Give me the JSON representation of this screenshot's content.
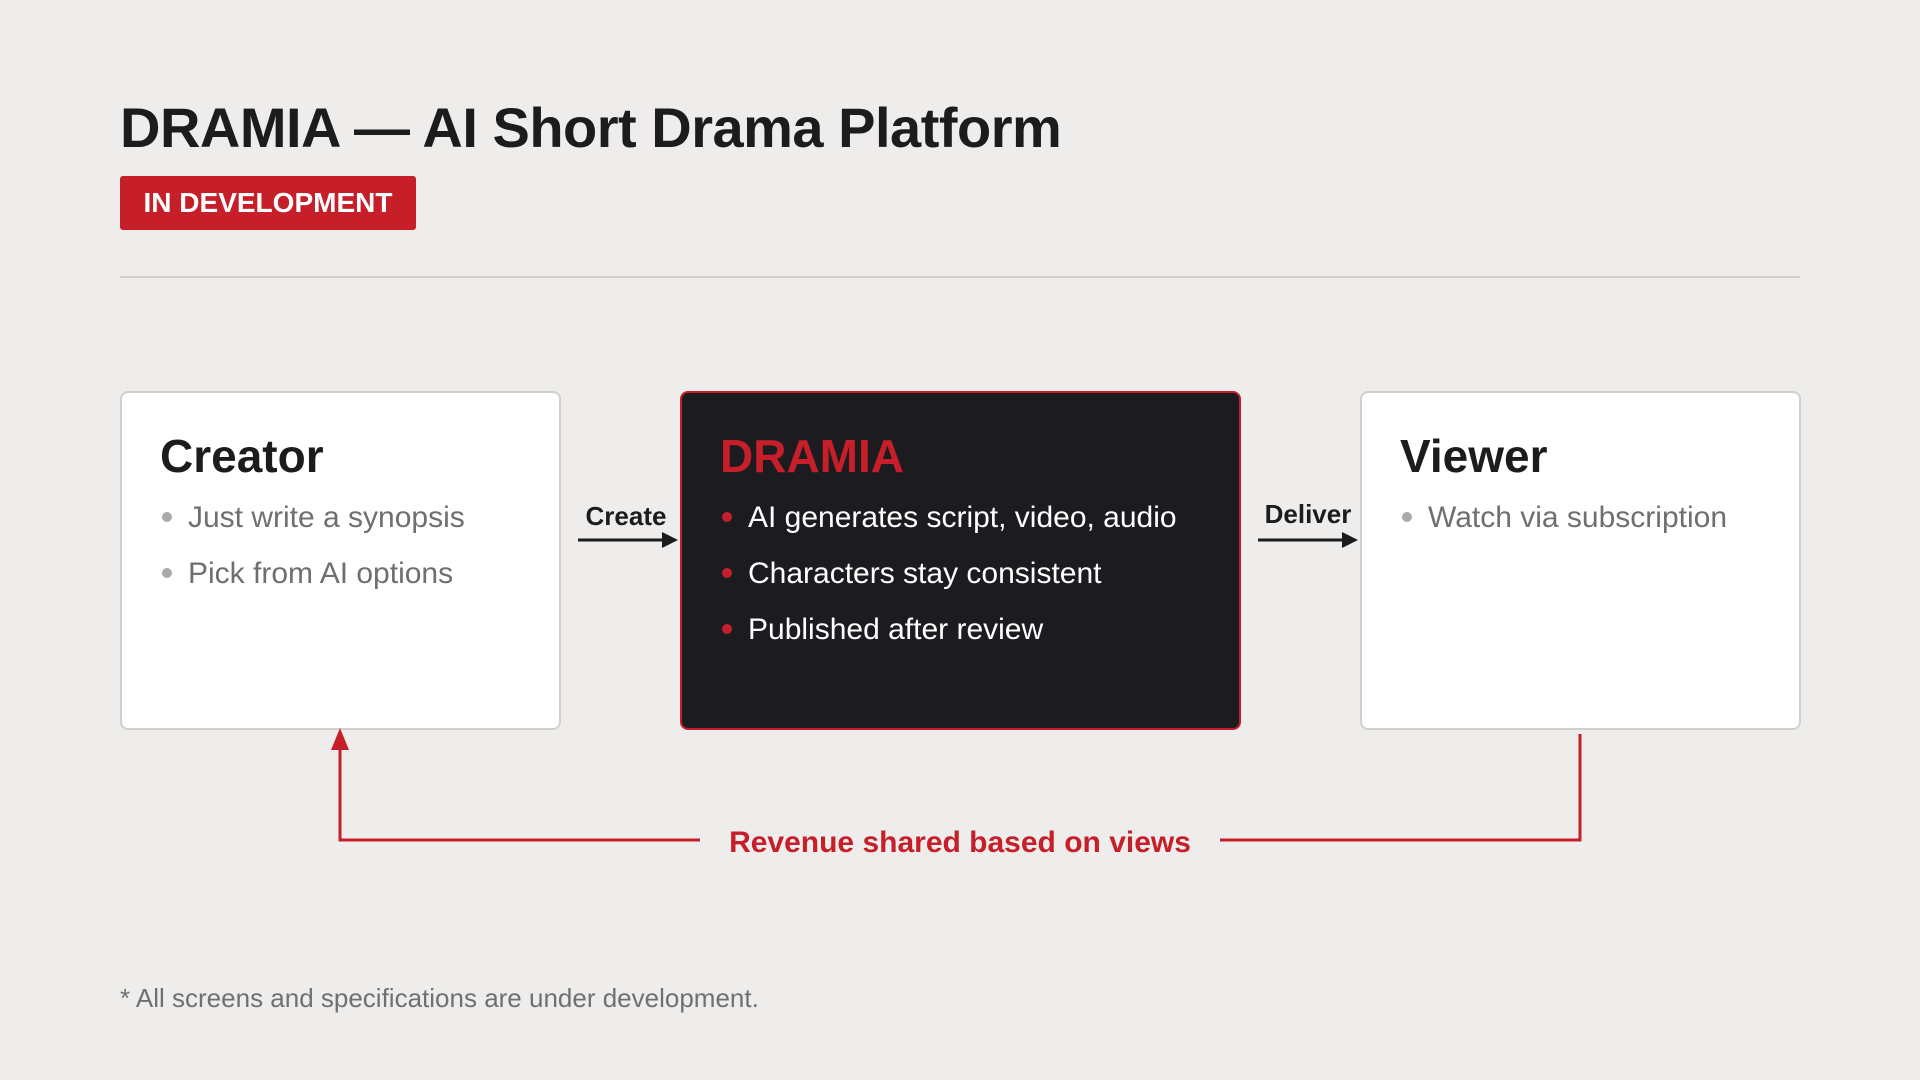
{
  "header": {
    "title": "DRAMIA — AI Short Drama Platform",
    "badge": "IN DEVELOPMENT"
  },
  "creator": {
    "title": "Creator",
    "bullets": [
      "Just write a synopsis",
      "Pick from AI options"
    ]
  },
  "platform": {
    "title": "DRAMIA",
    "bullets": [
      "AI generates script, video, audio",
      "Characters stay consistent",
      "Published after review"
    ]
  },
  "viewer": {
    "title": "Viewer",
    "bullets": [
      "Watch via subscription"
    ]
  },
  "arrows": {
    "create": "Create",
    "deliver": "Deliver",
    "revenue": "Revenue shared based on views"
  },
  "footnote": "* All screens and specifications are under development.",
  "colors": {
    "accent": "#c61f2a",
    "dark_box": "#1c1b1f",
    "background": "#eeedeb"
  }
}
